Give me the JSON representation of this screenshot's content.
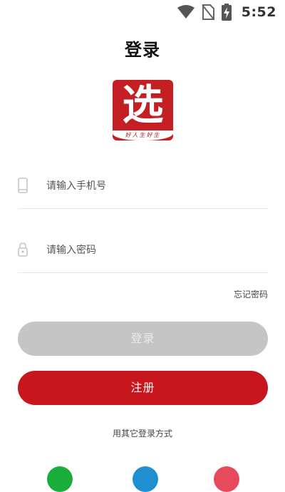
{
  "status_bar": {
    "time": "5:52",
    "icons": [
      "wifi-icon",
      "no-sim-icon",
      "battery-charging-icon"
    ]
  },
  "header": {
    "title": "登录"
  },
  "logo": {
    "character": "选",
    "tagline": "好人生好生",
    "color": "#c41f23"
  },
  "form": {
    "phone_placeholder": "请输入手机号",
    "phone_value": "",
    "password_placeholder": "请输入密码",
    "password_value": "",
    "forgot_label": "忘记密码"
  },
  "buttons": {
    "login_label": "登录",
    "register_label": "注册"
  },
  "other_login": {
    "label": "用其它登录方式",
    "options": [
      {
        "name": "wechat",
        "color": "#1aad3b"
      },
      {
        "name": "qq",
        "color": "#1f8fcf"
      },
      {
        "name": "weibo",
        "color": "#e64a5c"
      }
    ]
  },
  "colors": {
    "accent": "#c8161d",
    "disabled_button": "#c5c5c5"
  }
}
